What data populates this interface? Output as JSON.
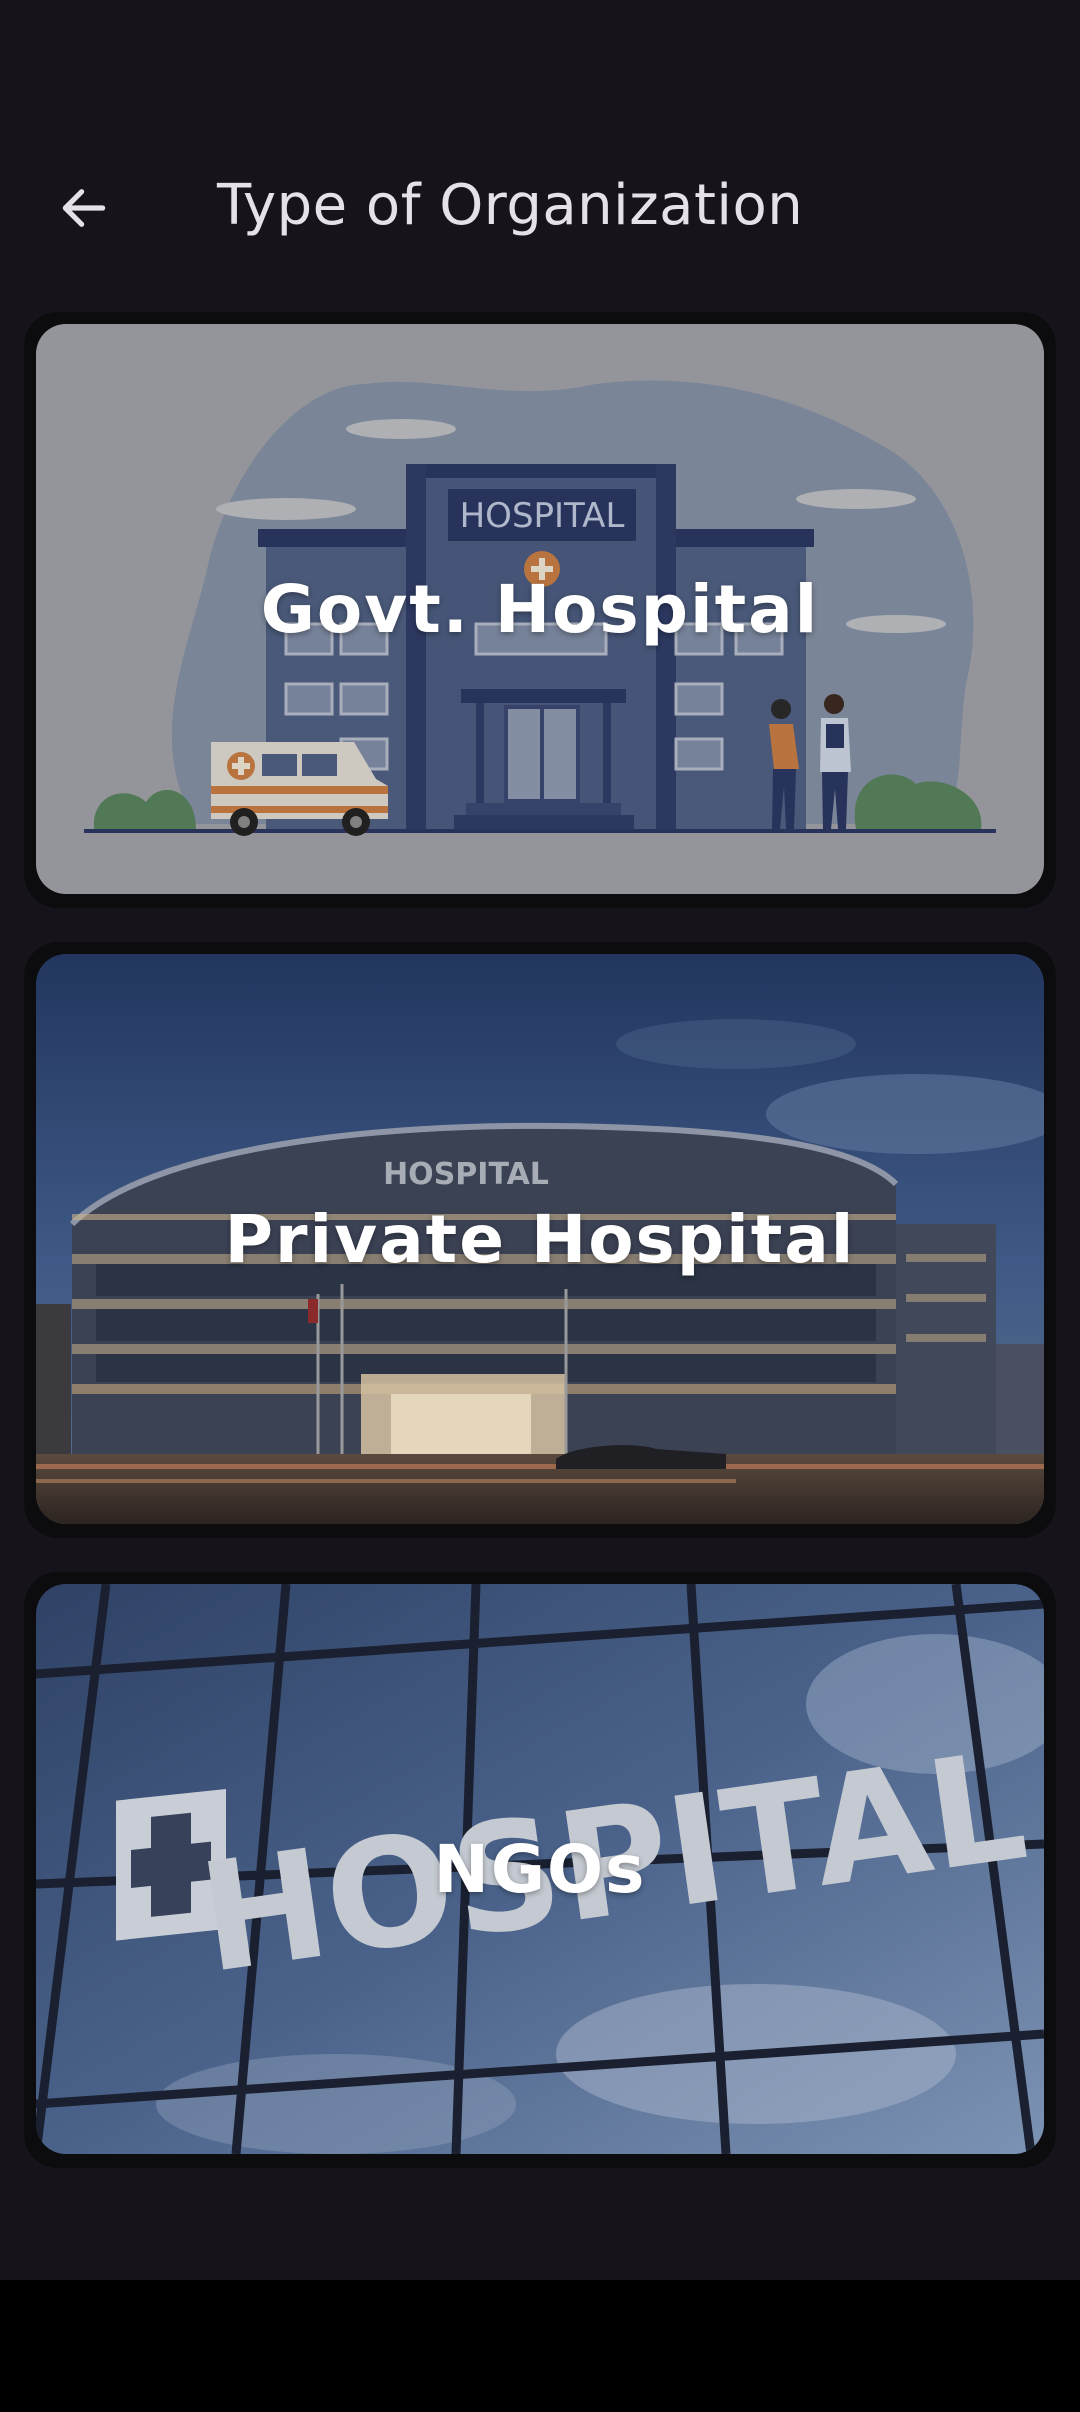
{
  "header": {
    "title": "Type of Organization",
    "back_icon": "arrow-left-icon"
  },
  "cards": [
    {
      "label": "Govt. Hospital",
      "image_sign": "HOSPITAL"
    },
    {
      "label": "Private Hospital",
      "image_sign": "HOSPITAL"
    },
    {
      "label": "NGOs",
      "image_sign": "HOSPITAL"
    }
  ],
  "colors": {
    "background": "#16141a",
    "text": "#e4e1e8",
    "card_label": "#ffffff"
  }
}
